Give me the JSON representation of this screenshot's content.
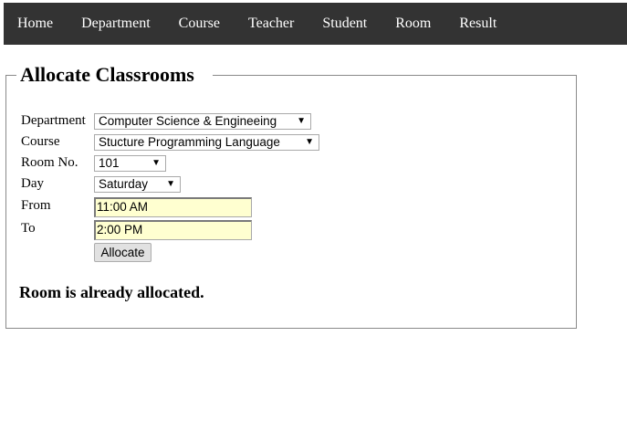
{
  "nav": {
    "items": [
      "Home",
      "Department",
      "Course",
      "Teacher",
      "Student",
      "Room",
      "Result"
    ]
  },
  "form": {
    "title": "Allocate Classrooms",
    "department": {
      "label": "Department",
      "value": "Computer Science & Engineeing"
    },
    "course": {
      "label": "Course",
      "value": "Stucture Programming Language"
    },
    "room": {
      "label": "Room No.",
      "value": "101"
    },
    "day": {
      "label": "Day",
      "value": "Saturday"
    },
    "from": {
      "label": "From",
      "value": "11:00 AM"
    },
    "to": {
      "label": "To",
      "value": "2:00 PM"
    },
    "submit_label": "Allocate",
    "message": "Room is already allocated."
  },
  "colors": {
    "navbar_bg": "#333333",
    "input_highlight": "#ffffd0"
  }
}
